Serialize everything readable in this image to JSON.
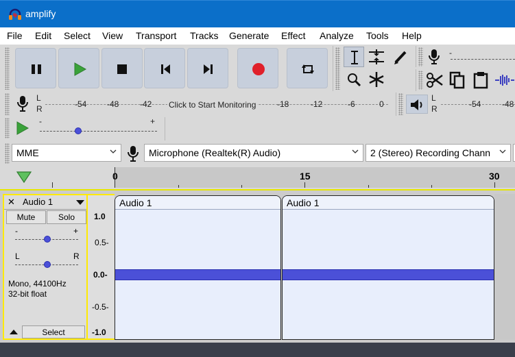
{
  "window": {
    "title": "amplify"
  },
  "menu": [
    "File",
    "Edit",
    "Select",
    "View",
    "Transport",
    "Tracks",
    "Generate",
    "Effect",
    "Analyze",
    "Tools",
    "Help"
  ],
  "record_meter": {
    "channels": [
      "L",
      "R"
    ],
    "scale": [
      "-54",
      "-48",
      "-42",
      "-18",
      "-12",
      "-6",
      "0"
    ],
    "prompt": "Click to Start Monitoring"
  },
  "playback_meter": {
    "channels": [
      "L",
      "R"
    ],
    "scale": [
      "-54",
      "-48"
    ]
  },
  "play_speed": {
    "minus": "-",
    "plus": "+"
  },
  "record_slider_minus": "-",
  "devices": {
    "host": "MME",
    "recording_device": "Microphone (Realtek(R) Audio)",
    "channels": "2 (Stereo) Recording Chann"
  },
  "ruler": {
    "labels": [
      "0",
      "15",
      "30"
    ]
  },
  "track": {
    "name": "Audio 1",
    "close": "✕",
    "mute": "Mute",
    "solo": "Solo",
    "gain_minus": "-",
    "gain_plus": "+",
    "pan_left": "L",
    "pan_right": "R",
    "info_line1": "Mono, 44100Hz",
    "info_line2": "32-bit float",
    "select": "Select",
    "y_axis": [
      "1.0",
      "0.5-",
      "0.0-",
      "-0.5-",
      "-1.0"
    ],
    "clips": [
      {
        "name": "Audio 1"
      },
      {
        "name": "Audio 1"
      }
    ]
  },
  "colors": {
    "titlebar": "#0b6fc9",
    "transport_button": "#c7cfdc",
    "waveform": "#4b50d8",
    "record": "#e0202a",
    "play": "#3aa23a",
    "focus": "#ffea00"
  }
}
